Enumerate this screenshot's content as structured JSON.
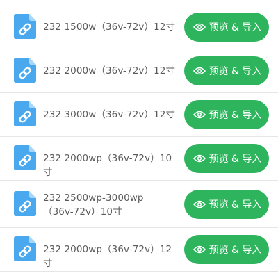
{
  "files": [
    {
      "name": "232 1500w（36v-72v）12寸",
      "action_label": "预览 & 导入"
    },
    {
      "name": "232 2000w（36v-72v）12寸",
      "action_label": "预览 & 导入"
    },
    {
      "name": "232 3000w（36v-72v）12寸",
      "action_label": "预览 & 导入"
    },
    {
      "name": "232 2000wp（36v-72v）10寸",
      "action_label": "预览 & 导入"
    },
    {
      "name": "232 2500wp-3000wp（36v-72v）10寸",
      "action_label": "预览 & 导入"
    },
    {
      "name": "232 2000wp（36v-72v）12寸",
      "action_label": "预览 & 导入"
    }
  ],
  "icons": {
    "file": "link-file-icon",
    "preview": "eye-icon"
  },
  "colors": {
    "button": "#2eb45c",
    "file_icon": "#4aa8ee",
    "text": "#5a5a5a"
  }
}
